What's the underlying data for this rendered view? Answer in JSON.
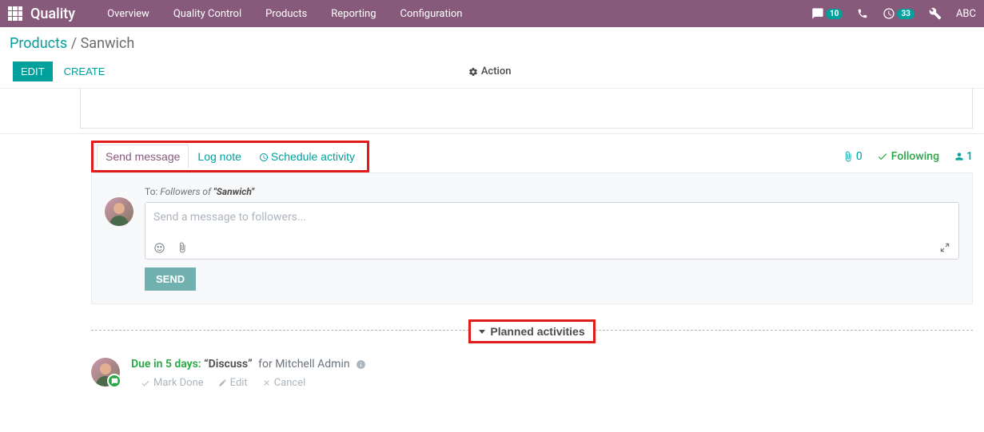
{
  "topbar": {
    "app_title": "Quality",
    "menu": [
      "Overview",
      "Quality Control",
      "Products",
      "Reporting",
      "Configuration"
    ],
    "discuss_badge": "10",
    "activities_badge": "33",
    "user_label": "ABC"
  },
  "breadcrumb": {
    "parent": "Products",
    "current": "Sanwich"
  },
  "buttons": {
    "edit": "EDIT",
    "create": "CREATE",
    "action": "Action"
  },
  "chatter_tabs": {
    "send_message": "Send message",
    "log_note": "Log note",
    "schedule_activity": "Schedule activity"
  },
  "chatter_tools": {
    "attach_count": "0",
    "following_label": "Following",
    "followers_count": "1"
  },
  "composer": {
    "to_prefix": "To:",
    "to_followers_of": "Followers of ",
    "to_record": "\"Sanwich\"",
    "placeholder": "Send a message to followers...",
    "send_label": "SEND"
  },
  "planned": {
    "header": "Planned activities"
  },
  "activity": {
    "due_label": "Due in 5 days:",
    "type": "“Discuss”",
    "for_prefix": "for",
    "assignee": "Mitchell Admin",
    "mark_done": "Mark Done",
    "edit": "Edit",
    "cancel": "Cancel"
  }
}
